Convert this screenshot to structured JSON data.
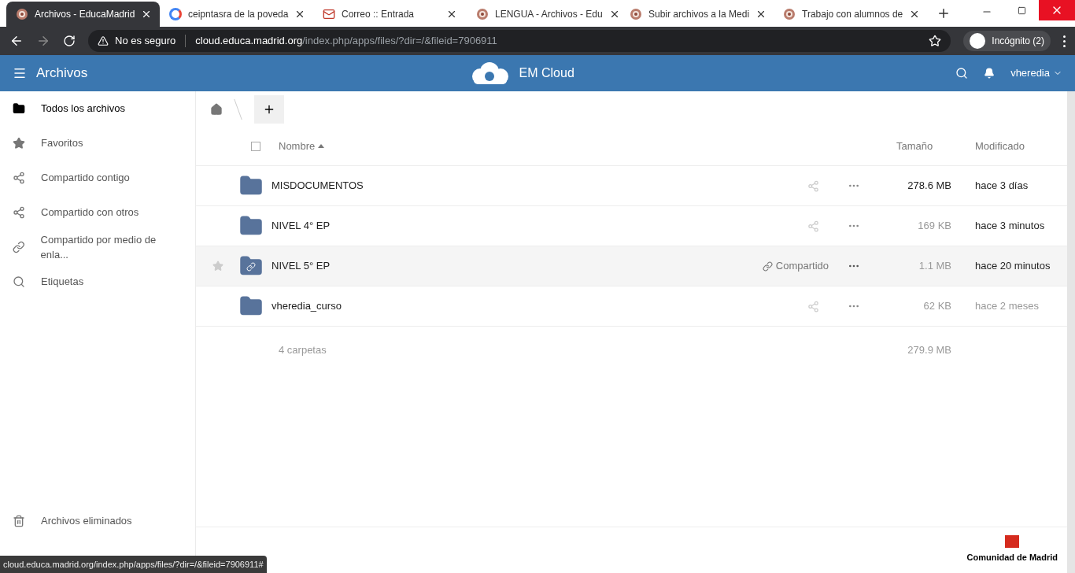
{
  "browser": {
    "tabs": [
      {
        "title": "Archivos - EducaMadrid",
        "selected": true,
        "kind": "emblem"
      },
      {
        "title": "ceipntasra de la poveda",
        "selected": false,
        "kind": "google"
      },
      {
        "title": "Correo :: Entrada",
        "selected": false,
        "kind": "mail"
      },
      {
        "title": "LENGUA - Archivos - Edu",
        "selected": false,
        "kind": "emblem"
      },
      {
        "title": "Subir archivos a la Medi",
        "selected": false,
        "kind": "emblem"
      },
      {
        "title": "Trabajo con alumnos de",
        "selected": false,
        "kind": "emblem"
      }
    ],
    "security": "No es seguro",
    "url_host": "cloud.educa.madrid.org",
    "url_path": "/index.php/apps/files/?dir=/&fileid=7906911",
    "profile": "Incógnito (2)"
  },
  "header": {
    "app": "Archivos",
    "brand": "EM Cloud",
    "user": "vheredia"
  },
  "sidebar": {
    "items": [
      {
        "label": "Todos los archivos",
        "kind": "folder",
        "selected": true
      },
      {
        "label": "Favoritos",
        "kind": "star",
        "selected": false
      },
      {
        "label": "Compartido contigo",
        "kind": "share",
        "selected": false
      },
      {
        "label": "Compartido con otros",
        "kind": "share",
        "selected": false
      },
      {
        "label": "Compartido por medio de enla...",
        "kind": "link",
        "selected": false
      },
      {
        "label": "Etiquetas",
        "kind": "search",
        "selected": false
      }
    ],
    "bottom": [
      {
        "label": "Archivos eliminados",
        "kind": "trash",
        "selected": false
      }
    ]
  },
  "table": {
    "columns": [
      "Nombre",
      "Tamaño",
      "Modificado"
    ],
    "select_all_checked": false,
    "rows": [
      {
        "name": "MISDOCUMENTOS",
        "size": "278.6 MB",
        "modified": "hace 3 días",
        "hovered": false,
        "shared_label": null
      },
      {
        "name": "NIVEL 4° EP",
        "size": "169 KB",
        "modified": "hace 3 minutos",
        "hovered": false,
        "shared_label": null
      },
      {
        "name": "NIVEL 5° EP",
        "size": "1.1 MB",
        "modified": "hace 20 minutos",
        "hovered": true,
        "shared_label": "Compartido"
      },
      {
        "name": "vheredia_curso",
        "size": "62 KB",
        "modified": "hace 2 meses",
        "hovered": false,
        "shared_label": null
      }
    ],
    "summary": {
      "count": "4 carpetas",
      "size": "279.9 MB"
    }
  },
  "footer_logo": "Comunidad de Madrid",
  "status_url": "cloud.educa.madrid.org/index.php/apps/files/?dir=/&fileid=7906911#"
}
